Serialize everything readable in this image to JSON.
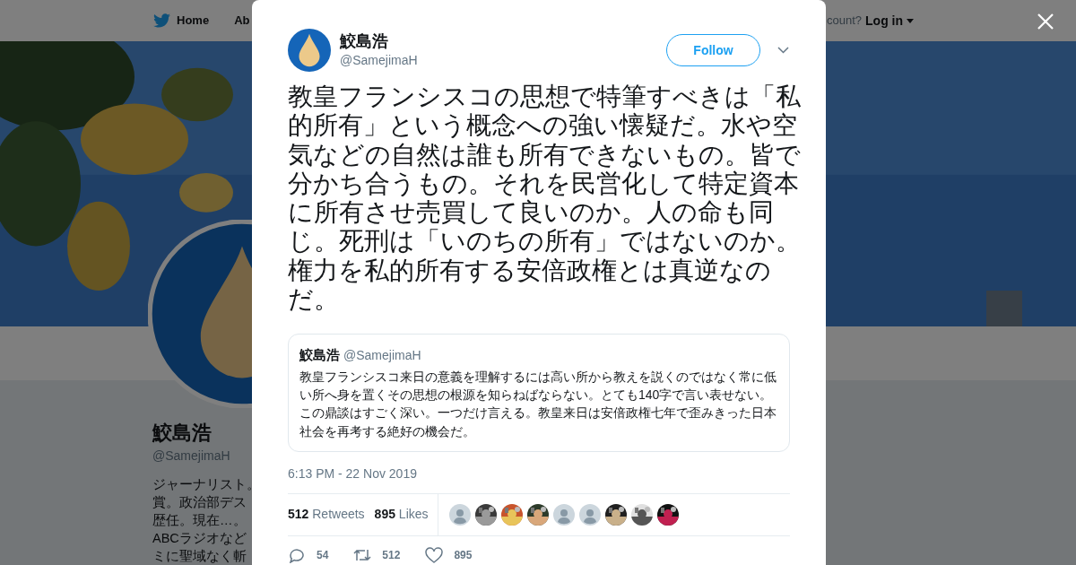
{
  "background_page": {
    "nav": [
      {
        "kind": "home",
        "label": "Home"
      },
      {
        "kind": "text",
        "label": "Ab"
      }
    ],
    "account_prompt": "count?",
    "login": "Log in",
    "profile": {
      "name": "鮫島浩",
      "handle": "@SamejimaH",
      "bio_lines": [
        "ジャーナリスト。",
        "賞。政治部デス",
        "歴任。現在…。",
        "ABCラジオなど",
        "ミに聖域なく斬"
      ]
    }
  },
  "modal": {
    "author": {
      "name": "鮫島浩",
      "handle": "@SamejimaH"
    },
    "follow_button": "Follow",
    "text": "教皇フランシスコの思想で特筆すべきは「私的所有」という概念への強い懐疑だ。水や空気などの自然は誰も所有できないもの。皆で分かち合うもの。それを民営化して特定資本に所有させ売買して良いのか。人の命も同じ。死刑は「いのちの所有」ではないのか。権力を私的所有する安倍政権とは真逆なのだ。",
    "quoted": {
      "name": "鮫島浩",
      "handle": "@SamejimaH",
      "text": "教皇フランシスコ来日の意義を理解するには高い所から教えを説くのではなく常に低い所へ身を置くその思想の根源を知らねばならない。とても140字で言い表せない。この鼎談はすごく深い。一つだけ言える。教皇来日は安倍政権七年で歪みきった日本社会を再考する絶好の機会だ。"
    },
    "timestamp": "6:13 PM - 22 Nov 2019",
    "stats": [
      {
        "count": "512",
        "label": "Retweets"
      },
      {
        "count": "895",
        "label": "Likes"
      }
    ],
    "likers": [
      {
        "kind": "default"
      },
      {
        "kind": "picture"
      },
      {
        "kind": "picture"
      },
      {
        "kind": "picture"
      },
      {
        "kind": "default"
      },
      {
        "kind": "default"
      },
      {
        "kind": "picture"
      },
      {
        "kind": "picture"
      },
      {
        "kind": "picture"
      }
    ],
    "actions": [
      {
        "kind": "reply",
        "count": "54"
      },
      {
        "kind": "retweet",
        "count": "512"
      },
      {
        "kind": "like",
        "count": "895"
      }
    ]
  }
}
